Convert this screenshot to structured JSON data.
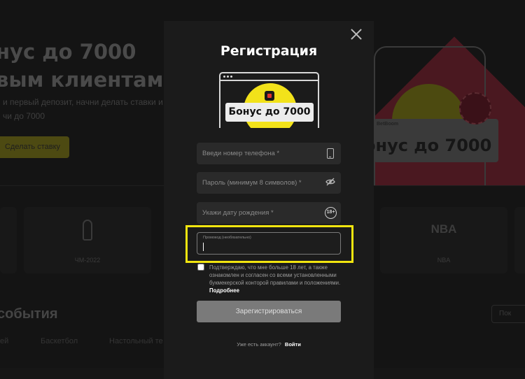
{
  "background": {
    "hero_title_line1": "нус до 7000",
    "hero_title_line2": "вым клиентам",
    "hero_subtitle_line1": "и первый депозит, начни делать ставки и",
    "hero_subtitle_line2": "чи до 7000",
    "hero_cta": "Сделать ставку",
    "cards": [
      {
        "label": "ЧМ-2022",
        "icon": "world-cup-icon"
      },
      {
        "label": "NBA",
        "icon": "nba-logo"
      }
    ],
    "nba_logo_text": "NBA",
    "art_brand": "BetBoom",
    "art_text": "онус до 7000",
    "events_title": "события",
    "tabs": [
      "ей",
      "Баскетбол",
      "Настольный те"
    ],
    "more_label": "Пок"
  },
  "modal": {
    "title": "Регистрация",
    "banner_text": "Бонус до 7000",
    "phone_placeholder": "Введи номер телефона *",
    "password_placeholder": "Пароль (минимум 8 символов) *",
    "birthdate_placeholder": "Укажи дату рождения *",
    "age_badge": "18+",
    "promo_label": "Промокод (необязательно)",
    "promo_value": "",
    "consent_text": "Подтверждаю, что мне больше 18 лет, а также ознакомлен и согласен со всеми установленными букмекерской конторой правилами и положениями.",
    "consent_more": "Подробнее",
    "consent_checked": false,
    "submit_label": "Зарегистрироваться",
    "login_prompt": "Уже есть аккаунт?",
    "login_link": "Войти"
  },
  "colors": {
    "accent_yellow": "#f1e50f",
    "modal_bg": "#1b1b1b",
    "field_bg": "#2a2a2a",
    "button_disabled": "#7a7a7a"
  }
}
